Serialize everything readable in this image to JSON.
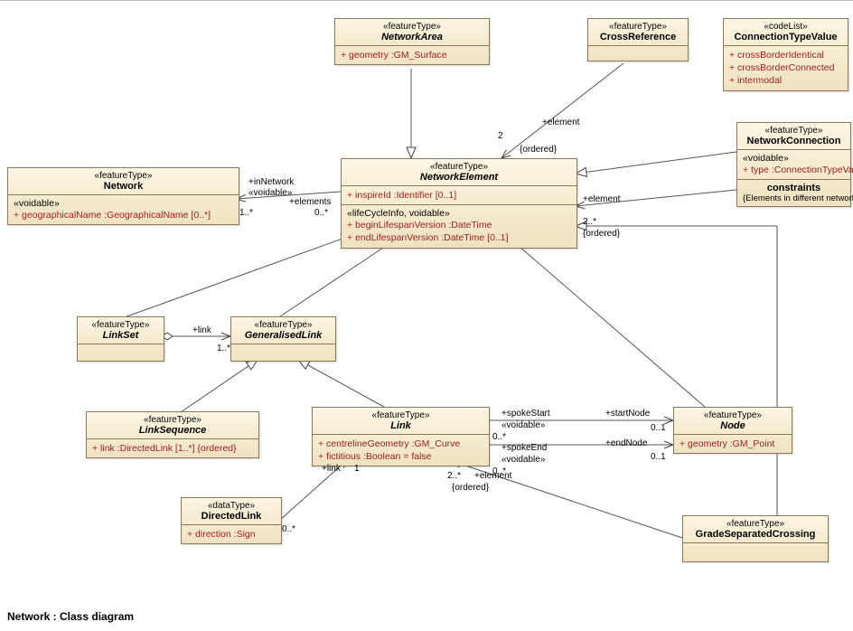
{
  "title": "Network : Class diagram",
  "stereotypes": {
    "featureType": "«featureType»",
    "dataType": "«dataType»",
    "codeList": "«codeList»",
    "voidable": "«voidable»",
    "lifeCycle": "«lifeCycleInfo, voidable»"
  },
  "classes": {
    "NetworkArea": {
      "name": "NetworkArea",
      "attrs": [
        "+   geometry  :GM_Surface"
      ]
    },
    "CrossReference": {
      "name": "CrossReference"
    },
    "ConnectionTypeValue": {
      "name": "ConnectionTypeValue",
      "attrs": [
        "+   crossBorderIdentical",
        "+   crossBorderConnected",
        "+   intermodal"
      ]
    },
    "NetworkConnection": {
      "name": "NetworkConnection",
      "voidableAttrs": [
        "+   type  :ConnectionTypeValue"
      ],
      "constraintsHeader": "constraints",
      "constraints": "{Elements in different networks}"
    },
    "Network": {
      "name": "Network",
      "voidableAttrs": [
        "+   geographicalName  :GeographicalName [0..*]"
      ]
    },
    "NetworkElement": {
      "name": "NetworkElement",
      "attrs": [
        "+   inspireId  :Identifier [0..1]"
      ],
      "lifeAttrs": [
        "+   beginLifespanVersion  :DateTime",
        "+   endLifespanVersion  :DateTime [0..1]"
      ]
    },
    "LinkSet": {
      "name": "LinkSet"
    },
    "GeneralisedLink": {
      "name": "GeneralisedLink"
    },
    "LinkSequence": {
      "name": "LinkSequence",
      "attrs": [
        "+   link  :DirectedLink [1..*] {ordered}"
      ]
    },
    "Link": {
      "name": "Link",
      "attrs": [
        "+   centrelineGeometry  :GM_Curve",
        "+   fictitious  :Boolean = false"
      ]
    },
    "DirectedLink": {
      "name": "DirectedLink",
      "attrs": [
        "+   direction  :Sign"
      ]
    },
    "Node": {
      "name": "Node",
      "attrs": [
        "+   geometry  :GM_Point"
      ]
    },
    "GradeSeparatedCrossing": {
      "name": "GradeSeparatedCrossing"
    }
  },
  "labels": {
    "inNetwork": "+inNetwork",
    "elements": "+elements",
    "voidable": "«voidable»",
    "oneStar": "1..*",
    "zeroStar": "0..*",
    "link": "+link",
    "element": "+element",
    "two": "2",
    "twoStar": "2..*",
    "ordered": "{ordered}",
    "spokeStart": "+spokeStart",
    "spokeEnd": "+spokeEnd",
    "startNode": "+startNode",
    "endNode": "+endNode",
    "zeroOne": "0..1",
    "one": "1"
  }
}
